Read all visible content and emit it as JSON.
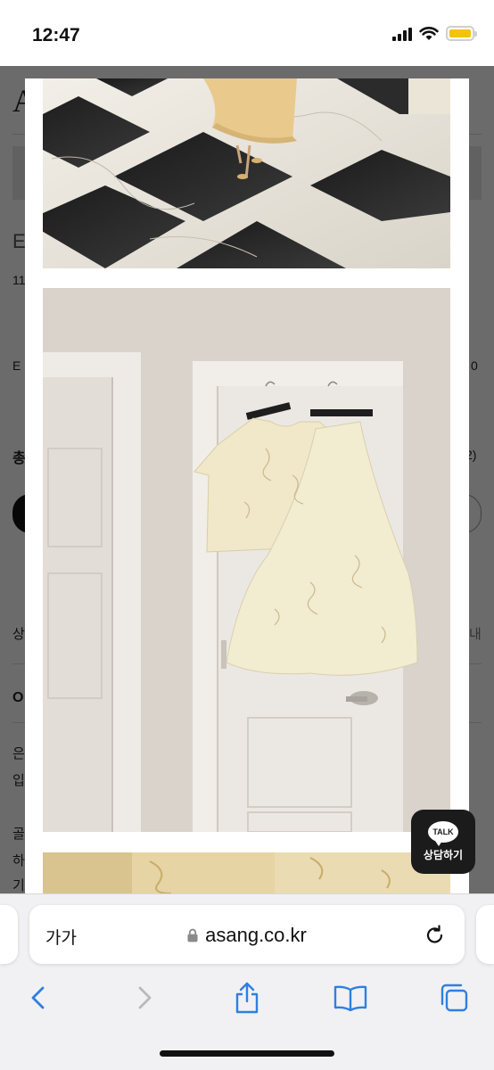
{
  "status_bar": {
    "time": "12:47",
    "icons": [
      "cellular-signal-icon",
      "wifi-icon",
      "battery-icon"
    ],
    "battery_color": "#f4c20d"
  },
  "background_page": {
    "fragments": [
      {
        "key": "logo",
        "text": "A"
      },
      {
        "key": "e1",
        "text": "E"
      },
      {
        "key": "n11",
        "text": "11"
      },
      {
        "key": "e2",
        "text": "E"
      },
      {
        "key": "zero",
        "text": "0"
      },
      {
        "key": "total",
        "text": "총"
      },
      {
        "key": "paren2",
        "text": "2)"
      },
      {
        "key": "sang",
        "text": "상"
      },
      {
        "key": "nae",
        "text": "내"
      },
      {
        "key": "o",
        "text": "O"
      },
      {
        "key": "eun",
        "text": "은"
      },
      {
        "key": "ip",
        "text": "입"
      },
      {
        "key": "gol",
        "text": "골"
      },
      {
        "key": "ha",
        "text": "하"
      },
      {
        "key": "gi",
        "text": "기"
      }
    ]
  },
  "lightbox": {
    "images": [
      {
        "name": "photo-marble-floor",
        "description_icon": "image-icon"
      },
      {
        "name": "photo-outfit-on-door",
        "description_icon": "image-icon"
      },
      {
        "name": "photo-fabric-closeup",
        "description_icon": "image-icon"
      }
    ]
  },
  "kakao": {
    "bubble_text": "TALK",
    "label": "상담하기"
  },
  "safari": {
    "aa_label": "가가",
    "url": "asang.co.kr",
    "toolbar": [
      "back-icon",
      "forward-icon",
      "share-icon",
      "bookmarks-icon",
      "tabs-icon"
    ],
    "accent": "#2f7fe0"
  }
}
